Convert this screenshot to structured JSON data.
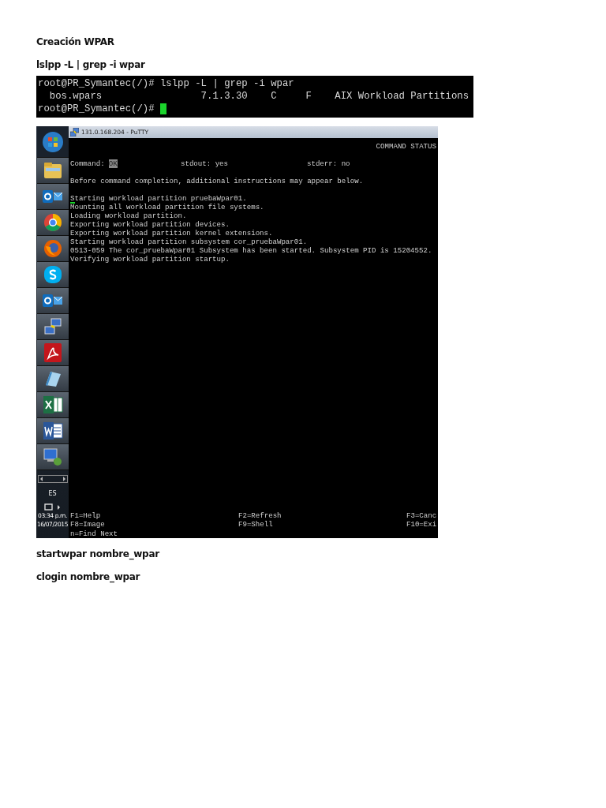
{
  "heading": "Creación WPAR",
  "command_1": "lslpp -L | grep -i wpar",
  "terminal": {
    "lines": [
      "root@PR_Symantec(/)# lslpp -L | grep -i wpar",
      "  bos.wpars                 7.1.3.30    C     F    AIX Workload Partitions",
      "root@PR_Symantec(/)# "
    ],
    "cursor": true
  },
  "screenshot": {
    "taskbar": {
      "icons": [
        {
          "kind": "start"
        },
        {
          "kind": "folder"
        },
        {
          "kind": "outlook"
        },
        {
          "kind": "chrome"
        },
        {
          "kind": "firefox"
        },
        {
          "kind": "skype"
        },
        {
          "kind": "outlook"
        },
        {
          "kind": "network"
        },
        {
          "kind": "pdf"
        },
        {
          "kind": "notes"
        },
        {
          "kind": "excel"
        },
        {
          "kind": "word"
        },
        {
          "kind": "computer"
        }
      ],
      "language": "ES",
      "time": "03:34 p.m.",
      "date": "16/07/2015"
    },
    "window_title": "131.0.168.204 - PuTTY",
    "screen_title": "COMMAND STATUS",
    "command_label": "Command:",
    "command_value": "OK",
    "stdout": "stdout: yes",
    "stderr": "stderr: no",
    "notice": "Before command completion, additional instructions may appear below.",
    "output": [
      "Starting workload partition pruebaWpar01.",
      "Mounting all workload partition file systems.",
      "Loading workload partition.",
      "Exporting workload partition devices.",
      "Exporting workload partition kernel extensions.",
      "Starting workload partition subsystem cor_pruebaWpar01.",
      "0513-059 The cor_pruebaWpar01 Subsystem has been started. Subsystem PID is 15204552.",
      "Verifying workload partition startup."
    ],
    "function_keys": [
      [
        "F1=Help",
        "F2=Refresh",
        "F3=Canc"
      ],
      [
        "F8=Image",
        "F9=Shell",
        "F10=Exi"
      ],
      [
        "n=Find Next"
      ]
    ]
  },
  "command_2": "startwpar nombre_wpar",
  "command_3": "clogin nombre_wpar"
}
